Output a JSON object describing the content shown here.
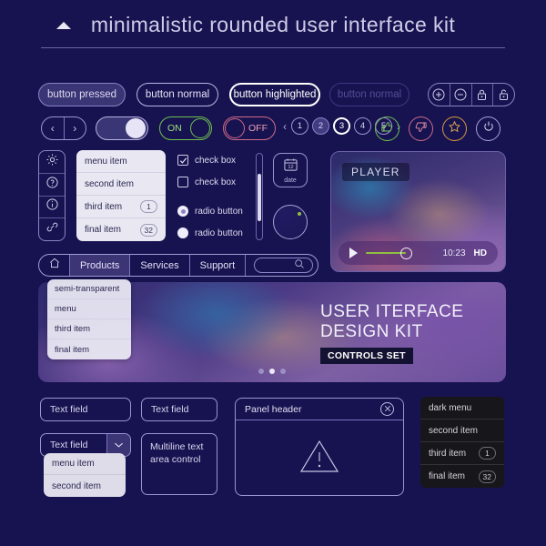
{
  "header": {
    "title": "minimalistic rounded user interface kit"
  },
  "buttons": {
    "pressed": "button pressed",
    "normal": "button normal",
    "highlighted": "button highlighted",
    "disabled": "button normal",
    "segmented": [
      "plus-icon",
      "minus-icon",
      "lock-closed-icon",
      "lock-open-icon"
    ]
  },
  "toggles": {
    "prev": "‹",
    "next": "›",
    "on_label": "ON",
    "off_label": "OFF",
    "on_color": "#6fbf4f",
    "off_color": "#d06a86"
  },
  "pager": {
    "prev": "‹",
    "next": "›",
    "pages": [
      "1",
      "2",
      "3",
      "4",
      "5"
    ],
    "active": "3"
  },
  "icon_circles": [
    {
      "name": "thumbs-up-icon",
      "color": "#6fbf4f"
    },
    {
      "name": "thumbs-down-icon",
      "color": "#cc6b86"
    },
    {
      "name": "star-icon",
      "color": "#d79a3e"
    },
    {
      "name": "power-icon",
      "color": "#a9a3dc"
    }
  ],
  "icon_rail": [
    "gear-icon",
    "help-icon",
    "info-icon",
    "link-icon"
  ],
  "light_menu": [
    {
      "label": "menu item",
      "badge": ""
    },
    {
      "label": "second item",
      "badge": ""
    },
    {
      "label": "third item",
      "badge": "1"
    },
    {
      "label": "final item",
      "badge": "32"
    }
  ],
  "checks": {
    "checked_label": "check box",
    "unchecked_label": "check box",
    "radio_selected_label": "radio button",
    "radio_unselected_label": "radio button"
  },
  "date_button": {
    "day": "12",
    "label": "date"
  },
  "player": {
    "badge": "PLAYER",
    "time": "10:23",
    "quality": "HD",
    "progress_color": "#8fbf3e"
  },
  "navbar": {
    "home": "home-icon",
    "items": [
      "Products",
      "Services",
      "Support"
    ],
    "active": "Products",
    "search_icon": "search-icon"
  },
  "semi_menu": [
    "semi-transparent",
    "menu",
    "third item",
    "final item"
  ],
  "hero": {
    "line1": "USER ITERFACE",
    "line2": "DESIGN KIT",
    "subtitle": "CONTROLS SET",
    "dots": 3,
    "active_dot": 2
  },
  "form": {
    "text_field_1": "Text field",
    "text_field_2": "Text field",
    "select_value": "Text field",
    "select_options": [
      "menu item",
      "second item"
    ],
    "textarea_value": "Multiline text area control"
  },
  "panel": {
    "header": "Panel header",
    "close": "close-icon",
    "body_icon": "warning-triangle-icon"
  },
  "dark_menu": [
    {
      "label": "dark menu",
      "badge": ""
    },
    {
      "label": "second item",
      "badge": ""
    },
    {
      "label": "third item",
      "badge": "1"
    },
    {
      "label": "final item",
      "badge": "32"
    }
  ]
}
